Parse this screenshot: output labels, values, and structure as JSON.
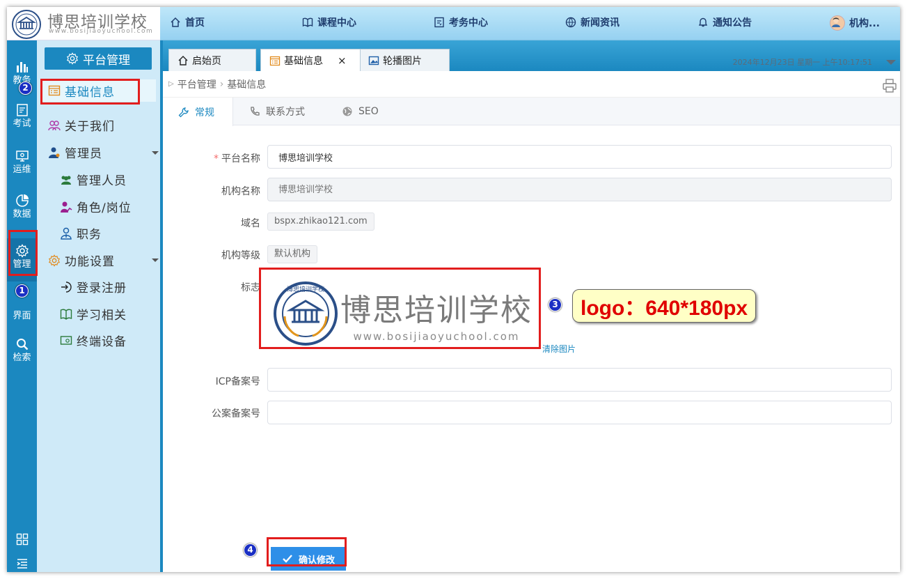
{
  "brand": {
    "name": "博思培训学校",
    "url": "www.bosijiaoyuchool.com",
    "emblem_text": "博思培训学校"
  },
  "topnav": {
    "home": "首页",
    "courses": "课程中心",
    "exams": "考务中心",
    "news": "新闻资讯",
    "notices": "通知公告",
    "user": "机构..."
  },
  "rail": {
    "teaching": "教务",
    "exam": "考试",
    "ops": "运维",
    "data": "数据",
    "manage": "管理",
    "ui": "界面",
    "search": "检索"
  },
  "submenu": {
    "title": "平台管理",
    "basic_info": "基础信息",
    "about_us": "关于我们",
    "admins": "管理员",
    "admin_staff": "管理人员",
    "roles": "角色/岗位",
    "duties": "职务",
    "features": "功能设置",
    "login_register": "登录注册",
    "learning": "学习相关",
    "devices": "终端设备"
  },
  "tabs": {
    "home": "启始页",
    "basic_info": "基础信息",
    "close": "×",
    "carousel": "轮播图片"
  },
  "datetime": "2024年12月23日 星期一 上午10:17:51",
  "breadcrumb": {
    "root": "平台管理",
    "sep": "›",
    "current": "基础信息"
  },
  "form_tabs": {
    "general": "常规",
    "contact": "联系方式",
    "seo": "SEO"
  },
  "form": {
    "platform_name_label": "平台名称",
    "platform_name_value": "博思培训学校",
    "org_name_label": "机构名称",
    "org_name_placeholder": "博思培训学校",
    "domain_label": "域名",
    "domain_value": "bspx.zhikao121.com",
    "org_level_label": "机构等级",
    "org_level_value": "默认机构",
    "logo_label": "标志",
    "logo_text": "博思培训学校",
    "logo_url": "www.bosijiaoyuchool.com",
    "clear_image": "清除图片",
    "icp_label": "ICP备案号",
    "icp_value": "",
    "police_label": "公案备案号",
    "police_value": "",
    "submit": "确认修改"
  },
  "annotations": {
    "step1": "1",
    "step2": "2",
    "step3": "3",
    "step4": "4",
    "logo_note": "logo：640*180px"
  },
  "colors": {
    "primary": "#1b88c0",
    "rail": "#1b88c0",
    "submenu_bg": "#cfeaf8",
    "topbar": "#96d1f1",
    "button": "#2e8fe8",
    "highlight": "#e21d1d",
    "required": "#f56c6c",
    "note_bg": "#ffffc6",
    "note_text": "#e00000"
  },
  "icons": [
    "home-icon",
    "book-icon",
    "exam-icon",
    "globe-icon",
    "bell-icon",
    "avatar",
    "chart-bars-icon",
    "exam-paper-icon",
    "monitor-gear-icon",
    "pie-icon",
    "gear-icon",
    "grid-icon",
    "search-icon",
    "list-icon",
    "calendar-list-icon",
    "users-icon",
    "user-admin-icon",
    "group-icon",
    "role-icon",
    "duty-icon",
    "settings-icon",
    "login-icon",
    "book-open-icon",
    "device-icon",
    "image-icon",
    "print-icon",
    "wrench-icon",
    "phone-icon",
    "globe-seo-icon",
    "check-icon"
  ]
}
